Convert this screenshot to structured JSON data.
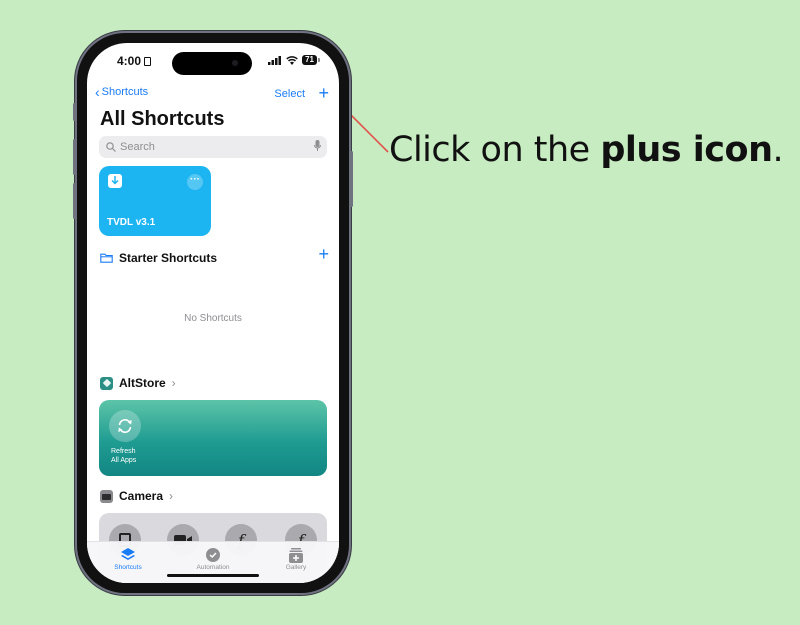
{
  "status_bar": {
    "time": "4:00",
    "battery": "71"
  },
  "nav": {
    "back_label": "Shortcuts",
    "select_label": "Select",
    "add_icon": "plus-icon"
  },
  "page_title": "All Shortcuts",
  "search": {
    "placeholder": "Search"
  },
  "shortcuts": [
    {
      "label": "TVDL v3.1",
      "color": "#1db4f2"
    }
  ],
  "sections": {
    "starter": {
      "title": "Starter Shortcuts",
      "empty_text": "No Shortcuts"
    },
    "altstore": {
      "title": "AltStore",
      "card_label_line1": "Refresh",
      "card_label_line2": "All Apps",
      "color": "#1f9c92"
    },
    "camera": {
      "title": "Camera"
    }
  },
  "tabbar": {
    "items": [
      {
        "label": "Shortcuts",
        "active": true
      },
      {
        "label": "Automation",
        "active": false
      },
      {
        "label": "Gallery",
        "active": false
      }
    ]
  },
  "annotation": {
    "prefix": "Click on the ",
    "bold": "plus icon",
    "suffix": ".",
    "line_color": "#e0524a"
  },
  "colors": {
    "background": "#c7ecc1",
    "accent": "#1a7cf5"
  }
}
